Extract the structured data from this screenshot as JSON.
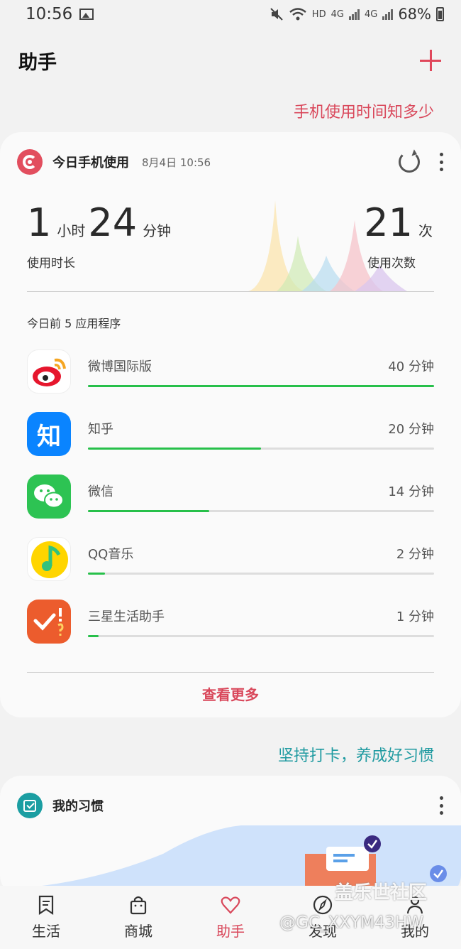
{
  "status": {
    "time": "10:56",
    "network": "HD",
    "net1": "4G",
    "net2": "4G",
    "battery": "68%"
  },
  "header": {
    "title": "助手"
  },
  "links": {
    "usage": "手机使用时间知多少",
    "habit": "坚持打卡，养成好习惯"
  },
  "usage_card": {
    "title": "今日手机使用",
    "date": "8月4日 10:56",
    "hours": "1",
    "hours_unit": "小时",
    "minutes": "24",
    "minutes_unit": "分钟",
    "duration_label": "使用时长",
    "count": "21",
    "count_unit": "次",
    "count_label": "使用次数",
    "top_title": "今日前 5 应用程序",
    "apps": [
      {
        "name": "微博国际版",
        "time": "40 分钟",
        "fraction": 1.0
      },
      {
        "name": "知乎",
        "time": "20 分钟",
        "fraction": 0.5
      },
      {
        "name": "微信",
        "time": "14 分钟",
        "fraction": 0.35
      },
      {
        "name": "QQ音乐",
        "time": "2 分钟",
        "fraction": 0.05
      },
      {
        "name": "三星生活助手",
        "time": "1 分钟",
        "fraction": 0.03
      }
    ],
    "zhihu_glyph": "知",
    "see_more": "查看更多"
  },
  "habit_card": {
    "title": "我的习惯"
  },
  "nav": [
    {
      "label": "生活",
      "icon": "bookmark-icon"
    },
    {
      "label": "商城",
      "icon": "shopping-bag-icon"
    },
    {
      "label": "助手",
      "icon": "heart-icon"
    },
    {
      "label": "发现",
      "icon": "compass-icon"
    },
    {
      "label": "我的",
      "icon": "person-icon"
    }
  ],
  "watermark": {
    "line1": "盖乐世社区",
    "line2": "@GC_XXYM43HW"
  },
  "colors": {
    "accent": "#d9485b",
    "teal": "#1e9aa0",
    "bar": "#27c04a"
  }
}
